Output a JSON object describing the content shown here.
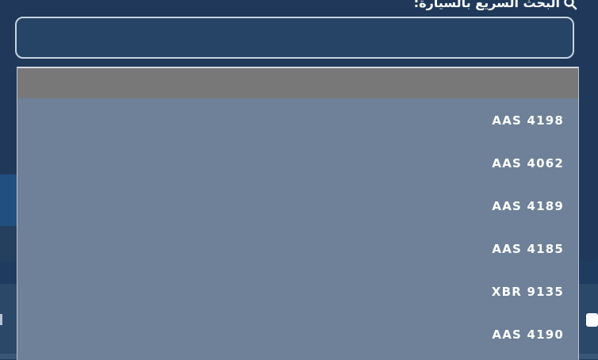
{
  "search": {
    "label": "البحث السريع بالسيارة:",
    "value": "",
    "placeholder": ""
  },
  "dropdown": {
    "items": [
      {
        "label": "AAS 4198"
      },
      {
        "label": "AAS 4062"
      },
      {
        "label": "AAS 4189"
      },
      {
        "label": "AAS 4185"
      },
      {
        "label": "XBR 9135"
      },
      {
        "label": "AAS 4190"
      }
    ]
  },
  "icons": {
    "search_label_icon": "search-icon"
  },
  "colors": {
    "page_background": "#1f3b5f",
    "input_background": "#264466",
    "dropdown_background": "#6e8198",
    "dropdown_header": "#787878"
  }
}
